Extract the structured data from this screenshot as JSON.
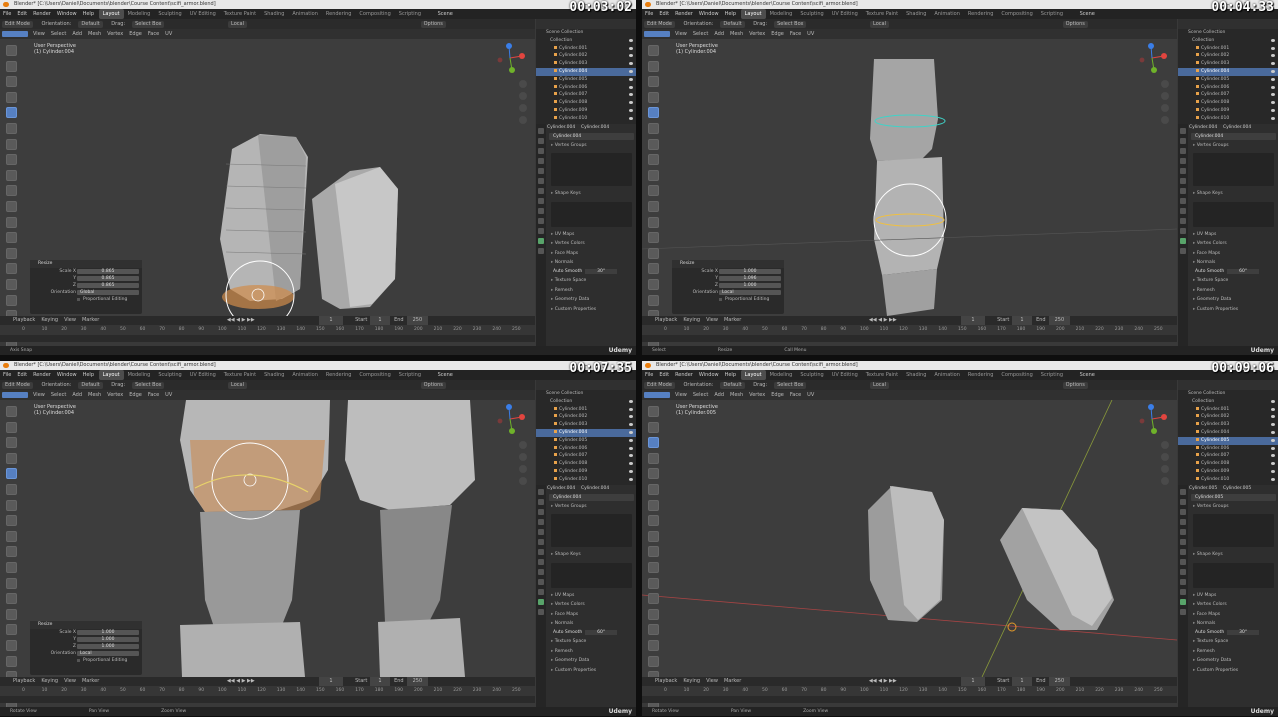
{
  "panels": [
    {
      "id": "p1",
      "title": "Blender* [C:\\Users\\Daniel\\Documents\\blender\\Course Content\\scifi_armor.blend]",
      "timestamp": "00:03:02",
      "mode": "Edit Mode",
      "viewport_label": "User Perspective",
      "object_label": "(1) Cylinder.004",
      "active_object": "Cylinder.004",
      "operator": {
        "name": "Resize",
        "scale_x": "0.865",
        "scale_y": "0.865",
        "scale_z": "0.865",
        "orientation": "Global"
      },
      "status": [
        "Axis Snap"
      ],
      "selected_index": 4,
      "auto_smooth_angle": "30°"
    },
    {
      "id": "p2",
      "title": "Blender* [C:\\Users\\Daniel\\Documents\\blender\\Course Content\\scifi_armor.blend]",
      "timestamp": "00:04:33",
      "mode": "Edit Mode",
      "viewport_label": "User Perspective",
      "object_label": "(1) Cylinder.004",
      "active_object": "Cylinder.004",
      "operator": {
        "name": "Resize",
        "scale_x": "1.000",
        "scale_y": "1.096",
        "scale_z": "1.000",
        "orientation": "Local"
      },
      "status": [
        "Select",
        "Resize",
        "Call Menu"
      ],
      "selected_index": 4,
      "auto_smooth_angle": "60°"
    },
    {
      "id": "p3",
      "title": "Blender* [C:\\Users\\Daniel\\Documents\\blender\\Course Content\\scifi_armor.blend]",
      "timestamp": "00:07:35",
      "mode": "Edit Mode",
      "viewport_label": "User Perspective",
      "object_label": "(1) Cylinder.004",
      "active_object": "Cylinder.004",
      "operator": {
        "name": "Resize",
        "scale_x": "1.000",
        "scale_y": "1.000",
        "scale_z": "1.000",
        "orientation": "Local"
      },
      "status": [
        "Rotate View",
        "Pan View",
        "Zoom View"
      ],
      "selected_index": 4,
      "auto_smooth_angle": "60°"
    },
    {
      "id": "p4",
      "title": "Blender* [C:\\Users\\Daniel\\Documents\\blender\\Course Content\\scifi_armor.blend]",
      "timestamp": "00:09:06",
      "mode": "Edit Mode",
      "viewport_label": "User Perspective",
      "object_label": "(1) Cylinder.005",
      "active_object": "Cylinder.005",
      "operator": null,
      "status": [
        "Rotate View",
        "Pan View",
        "Zoom View"
      ],
      "selected_index": 5,
      "auto_smooth_angle": "30°"
    }
  ],
  "menus": [
    "File",
    "Edit",
    "Render",
    "Window",
    "Help"
  ],
  "workspaces": [
    "Layout",
    "Modeling",
    "Sculpting",
    "UV Editing",
    "Texture Paint",
    "Shading",
    "Animation",
    "Rendering",
    "Compositing",
    "Scripting"
  ],
  "active_workspace": "Layout",
  "scene_label": "Scene",
  "tool_header": {
    "orientation_label": "Orientation:",
    "orientation_value": "Default",
    "drag_label": "Drag:",
    "drag_value": "Select Box",
    "transform_space": "Local",
    "options": "Options"
  },
  "viewport_menus": [
    "View",
    "Select",
    "Add",
    "Mesh",
    "Vertex",
    "Edge",
    "Face",
    "UV"
  ],
  "outliner": {
    "scene_collection": "Scene Collection",
    "collection": "Collection",
    "items": [
      "Cylinder.001",
      "Cylinder.002",
      "Cylinder.003",
      "Cylinder.004",
      "Cylinder.005",
      "Cylinder.006",
      "Cylinder.007",
      "Cylinder.008",
      "Cylinder.009",
      "Cylinder.010"
    ]
  },
  "properties": {
    "vertex_groups": "Vertex Groups",
    "shape_keys": "Shape Keys",
    "sections": [
      "UV Maps",
      "Vertex Colors",
      "Face Maps",
      "Normals"
    ],
    "auto_smooth": "Auto Smooth",
    "sections2": [
      "Texture Space",
      "Remesh",
      "Geometry Data",
      "Custom Properties"
    ]
  },
  "operator_labels": {
    "scale_x": "Scale X",
    "y": "Y",
    "z": "Z",
    "orientation": "Orientation",
    "proportional": "Proportional Editing"
  },
  "timeline": {
    "menus": [
      "Playback",
      "Keying",
      "View",
      "Marker"
    ],
    "current_frame": "1",
    "start_label": "Start",
    "start": "1",
    "end_label": "End",
    "end": "250",
    "ticks": [
      "0",
      "10",
      "20",
      "30",
      "40",
      "50",
      "60",
      "70",
      "80",
      "90",
      "100",
      "110",
      "120",
      "130",
      "140",
      "150",
      "160",
      "170",
      "180",
      "190",
      "200",
      "210",
      "220",
      "230",
      "240",
      "250"
    ]
  },
  "watermark": "Udemy"
}
